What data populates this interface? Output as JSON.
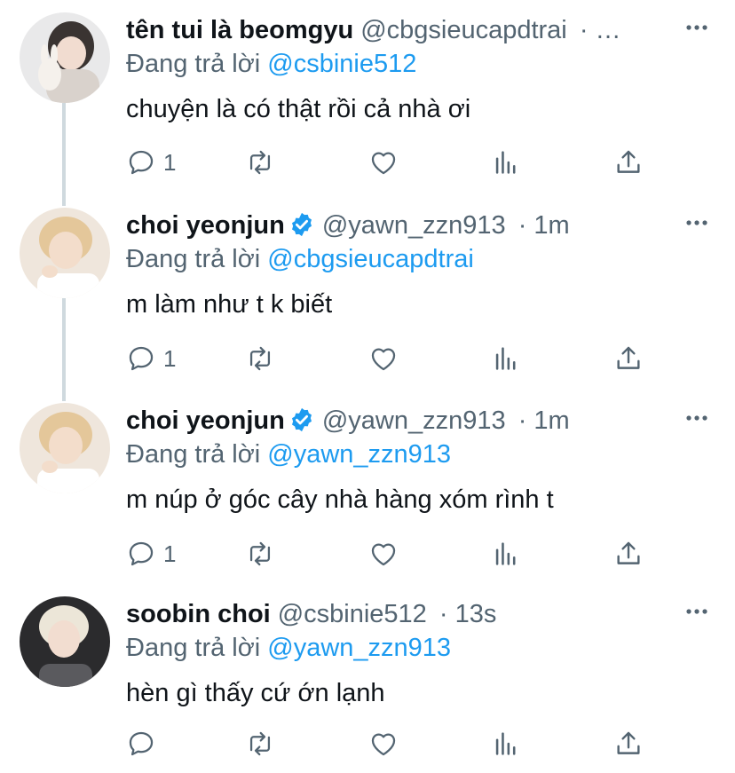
{
  "colors": {
    "text": "#0f1419",
    "secondary": "#536471",
    "accent": "#1d9bf0",
    "thread_line": "#cfd9de"
  },
  "icons": {
    "more": "more-dots-icon",
    "reply": "reply-icon",
    "retweet": "retweet-icon",
    "like": "heart-icon",
    "analytics": "analytics-icon",
    "share": "share-icon",
    "verified": "verified-badge-icon"
  },
  "tweets": [
    {
      "display_name": "tên tui là beomgyu",
      "handle": "@cbgsieucapdtrai",
      "time": "· …",
      "verified": false,
      "reply_prefix": "Đang trả lời",
      "reply_to": "@csbinie512",
      "text": "chuyện là có thật rồi cả nhà ơi",
      "reply_count": "1"
    },
    {
      "display_name": "choi yeonjun",
      "handle": "@yawn_zzn913",
      "time": "· 1m",
      "verified": true,
      "reply_prefix": "Đang trả lời",
      "reply_to": "@cbgsieucapdtrai",
      "text": "m làm như t k biết",
      "reply_count": "1"
    },
    {
      "display_name": "choi yeonjun",
      "handle": "@yawn_zzn913",
      "time": "· 1m",
      "verified": true,
      "reply_prefix": "Đang trả lời",
      "reply_to": "@yawn_zzn913",
      "text": "m núp ở góc cây nhà hàng xóm rình t",
      "reply_count": "1"
    },
    {
      "display_name": "soobin choi",
      "handle": "@csbinie512",
      "time": "· 13s",
      "verified": false,
      "reply_prefix": "Đang trả lời",
      "reply_to": "@yawn_zzn913",
      "text": "hèn gì thấy cứ ớn lạnh",
      "reply_count": ""
    }
  ]
}
